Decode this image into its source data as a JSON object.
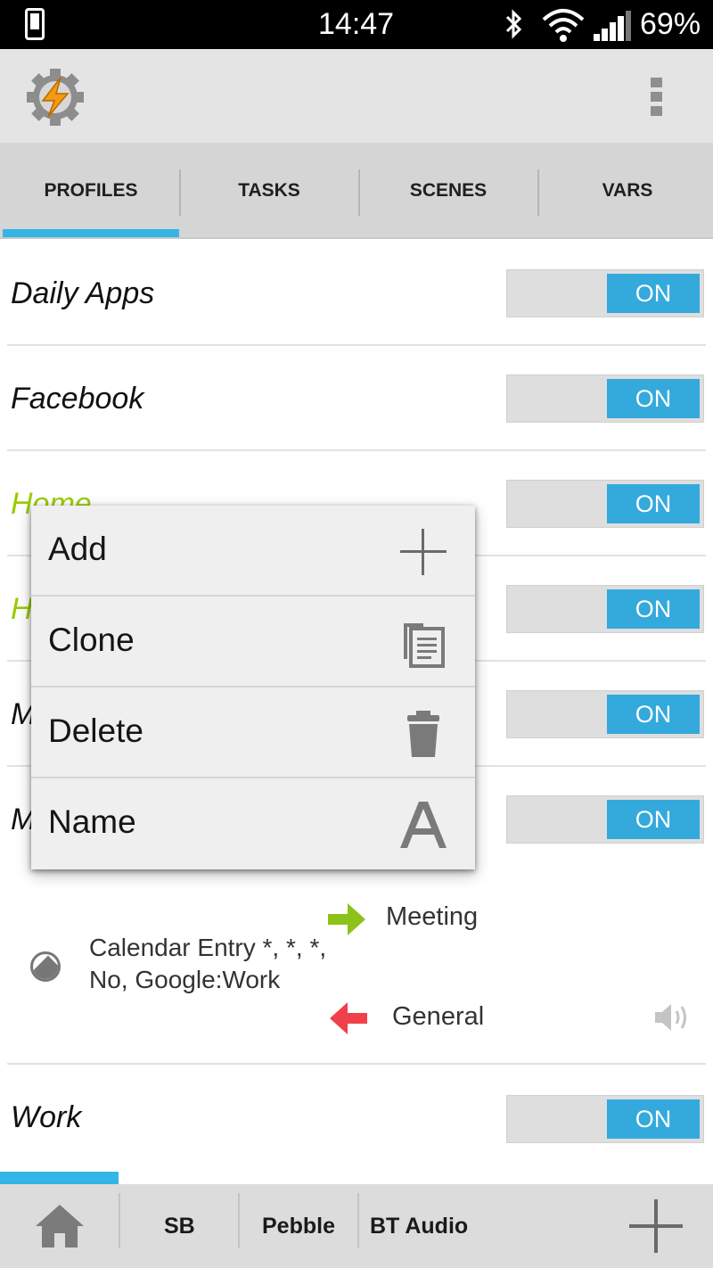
{
  "status_bar": {
    "time": "14:47",
    "battery": "69%"
  },
  "action_bar": {
    "app_icon": "gear-lightning-icon",
    "overflow_icon": "overflow-menu-icon"
  },
  "tabs": [
    {
      "label": "PROFILES",
      "selected": true
    },
    {
      "label": "TASKS",
      "selected": false
    },
    {
      "label": "SCENES",
      "selected": false
    },
    {
      "label": "VARS",
      "selected": false
    }
  ],
  "profiles": [
    {
      "name": "Daily Apps",
      "toggle": "ON"
    },
    {
      "name": "Facebook",
      "toggle": "ON"
    },
    {
      "name": "Home",
      "toggle": "ON"
    },
    {
      "name": "H",
      "toggle": "ON"
    },
    {
      "name": "M",
      "toggle": "ON"
    },
    {
      "name": "M",
      "toggle": "ON"
    },
    {
      "name": "Work",
      "toggle": "ON"
    }
  ],
  "expanded_profile": {
    "context_icon": "calendar-context-icon",
    "context": "Calendar Entry *, *, *, No, Google:Work",
    "enter_task": "Meeting",
    "exit_task": "General",
    "enter_icon": "green-right-arrow-icon",
    "exit_icon": "red-left-arrow-icon",
    "exit_extra_icon": "volume-icon"
  },
  "popup_menu": [
    {
      "label": "Add",
      "icon": "plus-icon"
    },
    {
      "label": "Clone",
      "icon": "copy-icon"
    },
    {
      "label": "Delete",
      "icon": "trash-icon"
    },
    {
      "label": "Name",
      "icon": "letter-a-icon"
    }
  ],
  "bottom_bar": {
    "home_icon": "home-icon",
    "projects": [
      "SB",
      "Pebble",
      "BT Audio"
    ],
    "add_icon": "plus-icon"
  },
  "colors": {
    "accent": "#33b5e5",
    "toggle_on": "#33a9dc",
    "active_profile": "#99cc00",
    "enter_arrow": "#8cc21a",
    "exit_arrow": "#f0414a"
  }
}
